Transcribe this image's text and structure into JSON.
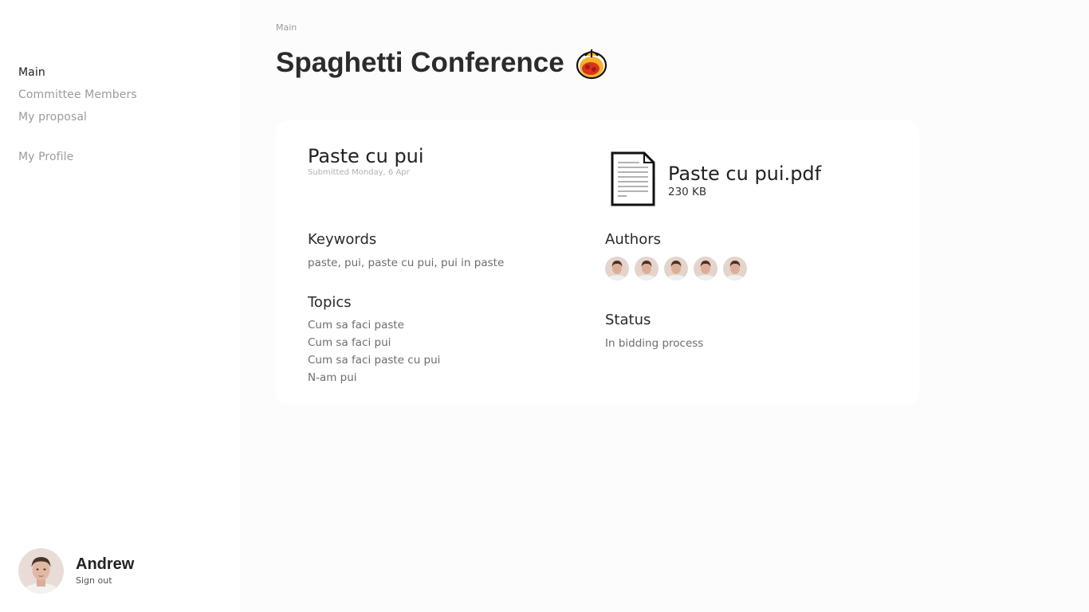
{
  "sidebar": {
    "nav": [
      {
        "label": "Main",
        "active": true
      },
      {
        "label": "Committee Members",
        "active": false
      },
      {
        "label": "My proposal",
        "active": false
      }
    ],
    "profile_link": "My Profile",
    "user": {
      "name": "Andrew",
      "sign_out": "Sign out"
    }
  },
  "main": {
    "breadcrumb": "Main",
    "title": "Spaghetti Conference",
    "title_icon": "spaghetti-icon"
  },
  "proposal": {
    "title": "Paste cu pui",
    "submitted": "Submitted Monday, 6 Apr",
    "file": {
      "name": "Paste cu pui.pdf",
      "size": "230 KB",
      "icon": "document-icon"
    },
    "keywords_heading": "Keywords",
    "keywords": "paste, pui, paste cu pui, pui in paste",
    "topics_heading": "Topics",
    "topics": [
      "Cum sa faci paste",
      "Cum sa faci pui",
      "Cum sa faci paste cu pui",
      "N-am pui"
    ],
    "authors_heading": "Authors",
    "authors_count": 5,
    "status_heading": "Status",
    "status": "In bidding process"
  },
  "colors": {
    "background": "#fcfcfc",
    "card": "#ffffff",
    "muted_text": "#9b9b9b"
  }
}
